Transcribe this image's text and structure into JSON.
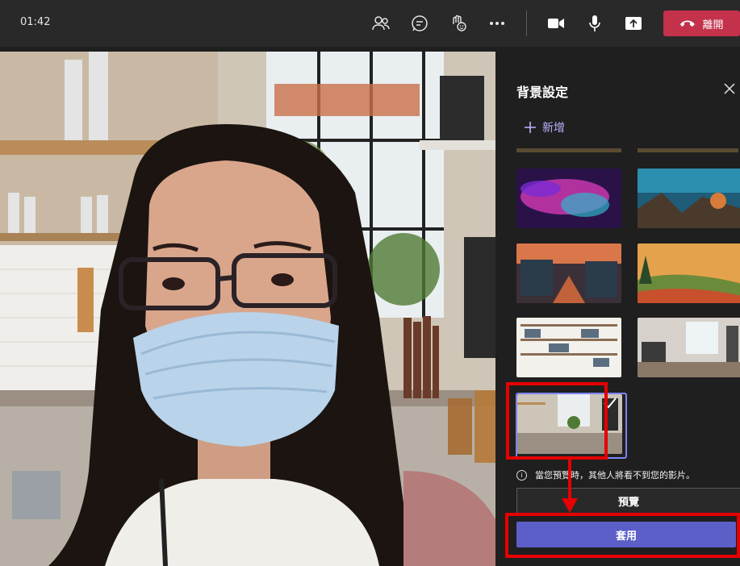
{
  "topbar": {
    "timer": "01:42",
    "icons": [
      "people-icon",
      "chat-icon",
      "reactions-icon",
      "more-icon",
      "camera-icon",
      "mic-icon",
      "share-icon"
    ],
    "leave_label": "離開",
    "leave_color": "#c4314b"
  },
  "panel": {
    "title": "背景設定",
    "add_label": "新增",
    "info_text": "當您預覽時，其他人將看不到您的影片。",
    "preview_label": "預覽",
    "apply_label": "套用",
    "accent_color": "#5b5fc7",
    "thumbnails": [
      {
        "name": "galaxy-background-thumb"
      },
      {
        "name": "fantasy-landscape-background-thumb"
      },
      {
        "name": "fantasy-village-background-thumb"
      },
      {
        "name": "autumn-valley-background-thumb"
      },
      {
        "name": "bookshelf-room-background-thumb"
      },
      {
        "name": "office-lounge-background-thumb"
      },
      {
        "name": "kitchen-background-thumb",
        "selected": true
      }
    ]
  },
  "annotation_color": "#e60000"
}
